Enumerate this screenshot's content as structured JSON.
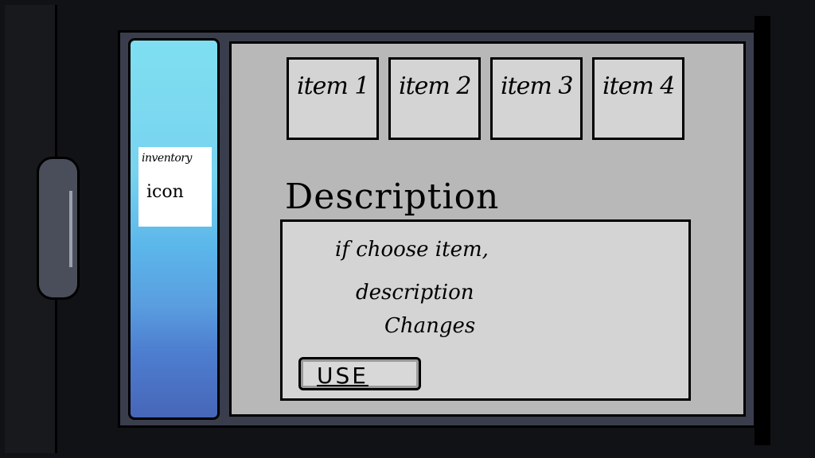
{
  "inventory": {
    "icon_label_line1": "inventory",
    "icon_label_line2": "icon"
  },
  "items": [
    {
      "label": "item 1"
    },
    {
      "label": "item 2"
    },
    {
      "label": "item 3"
    },
    {
      "label": "item 4"
    }
  ],
  "description": {
    "title": "Description",
    "lines": [
      "if choose item,",
      "description",
      "Changes"
    ]
  },
  "actions": {
    "use_label": "USE"
  }
}
